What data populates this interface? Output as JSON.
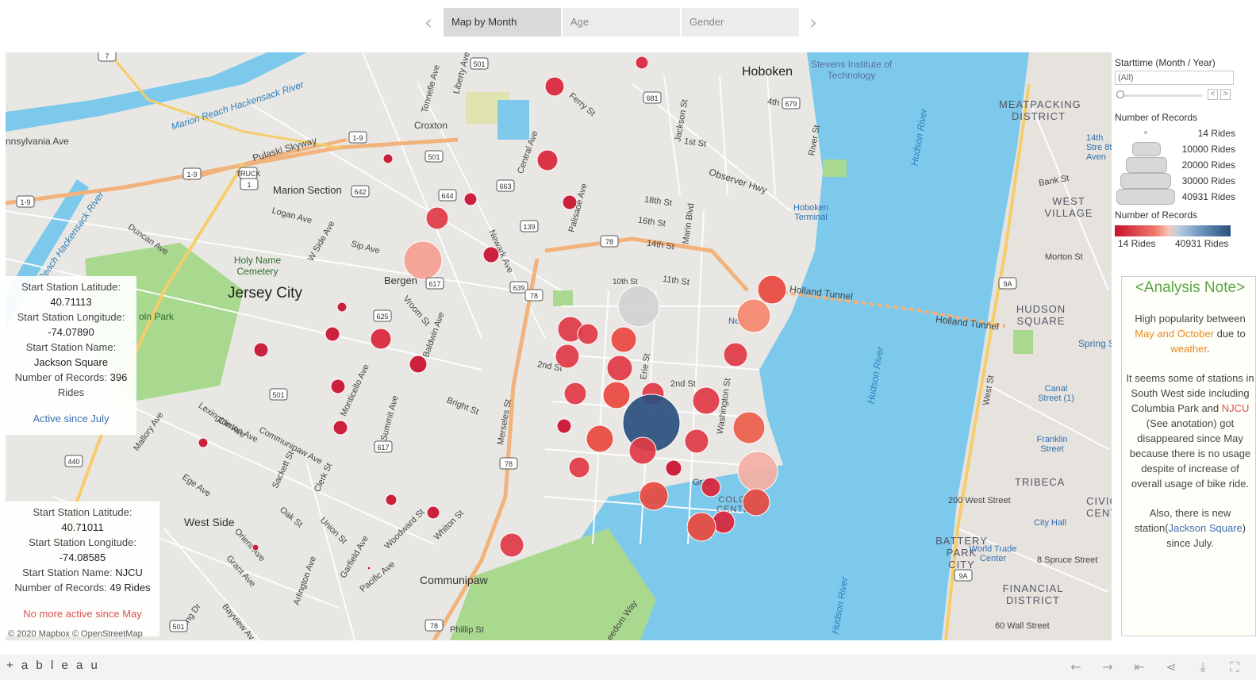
{
  "story": {
    "points": [
      {
        "label": "Map by Month",
        "active": true
      },
      {
        "label": "Age",
        "active": false
      },
      {
        "label": "Gender",
        "active": false
      }
    ],
    "prev_icon": "chevron-left-icon",
    "next_icon": "chevron-right-icon"
  },
  "map": {
    "labels": {
      "croxton": "Croxton",
      "hoboken": "Hoboken",
      "stevens": "Stevens Institute of Technology",
      "marion_section": "Marion Section",
      "jersey_city": "Jersey City",
      "bergen": "Bergen",
      "holy_name": "Holy Name Cemetery",
      "west_side": "West Side",
      "communipaw": "Communipaw",
      "holland_tunnel": "Holland Tunnel",
      "holland_tunnel_2": "Holland Tunnel",
      "hudson_river": "Hudson River",
      "hudson_river_2": "Hudson River",
      "hudson_river_3": "Hudson River",
      "marion_river": "Marion Reach Hackensack River",
      "reach_river": "Reach Hackensack River",
      "pennsylvania_ave": "nnsylvania Ave",
      "pulaski": "Pulaski Skyway",
      "observer": "Observer Hwy",
      "hoboken_terminal": "Hoboken Terminal",
      "meatpacking": "MEATPACKING DISTRICT",
      "west_village": "WEST VILLAGE",
      "hudson_square": "HUDSON SQUARE",
      "tribeca": "TRIBECA",
      "battery": "BATTERY PARK CITY",
      "financial": "FINANCIAL DISTRICT",
      "civic": "CIVIC CENTE",
      "spring": "Spring Street",
      "canal": "Canal Street (1)",
      "franklin": "Franklin Street",
      "city_hall": "City Hall",
      "wtc": "World Trade Center",
      "west_200": "200 West Street",
      "spruce": "8 Spruce Street",
      "wall_60": "60 Wall Street",
      "st14_8ave": "14th Stre 8th Aven",
      "west_st": "West St",
      "bank_st": "Bank St",
      "morton_st": "Morton St",
      "duncan": "Duncan Ave",
      "logan": "Logan Ave",
      "sip": "Sip Ave",
      "montgomery": "Montgomery",
      "monticello": "Monticello Ave",
      "summit": "Summit Ave",
      "communipaw_ave": "Communipaw Ave",
      "clinton": "Clinton Ave",
      "st18": "18th St",
      "st16": "16th St",
      "st14": "14th St",
      "st11": "11th St",
      "st10": "10th St",
      "st2": "2nd St",
      "st2b": "2nd St",
      "marin": "Marin Blvd",
      "washington": "Washington St",
      "erie": "Erie St",
      "grand": "Gr St",
      "colg": "COLG CENTE",
      "ne": "Ne",
      "lincoln_park": "oln Park",
      "bright": "Bright St",
      "merseles": "Merseles St",
      "newark": "Newark Ave",
      "palisade": "Palisade Ave",
      "central": "Central Ave",
      "ferry": "Ferry St",
      "st4": "4th St",
      "st1": "1st St",
      "jackson_st": "Jackson St",
      "river_st": "River St",
      "phillip": "Phillip St",
      "pacific": "Pacific Ave",
      "freedom": "eedom Way",
      "whiton": "Whiton St",
      "woodward": "Woodward St",
      "garfield": "Garfield Ave",
      "arlington": "Arlington Ave",
      "king": "King Dr",
      "bayview": "Bayview Av",
      "grant": "Grant Ave",
      "orient": "Orient Ave",
      "ege": "Ege Ave",
      "mallory": "Mallory Ave",
      "lexington": "Lexington Ave",
      "oak": "Oak St",
      "union": "Union St",
      "clerk": "Clerk St",
      "sackett": "Sackett St",
      "vroom": "Vroom St",
      "baldwin": "Baldwin Ave",
      "tonnelle": "Tonnelle Ave",
      "liberty": "Liberty Ave",
      "w_side": "W Side Ave"
    },
    "shields": [
      "7",
      "1-9",
      "1-9",
      "1-9",
      "501",
      "501",
      "501",
      "501",
      "642",
      "644",
      "663",
      "625",
      "617",
      "617",
      "639",
      "139",
      "440",
      "681",
      "679",
      "78",
      "78",
      "78",
      "78",
      "9A",
      "9A",
      "1",
      "TRUCK"
    ],
    "tooltip_jackson": {
      "lat_label": "Start Station Latitude:",
      "lat_value": "40.71113",
      "lon_label": "Start Station Longitude:",
      "lon_value": "-74.07890",
      "name_label": "Start Station Name:",
      "name_value": "Jackson Square",
      "records_label": "Number of Records:",
      "records_value": "396",
      "records_unit": "Rides",
      "note": "Active since July"
    },
    "tooltip_njcu": {
      "lat_label": "Start Station Latitude:",
      "lat_value": "40.71011",
      "lon_label": "Start Station Longitude:",
      "lon_value": "-74.08585",
      "name_label": "Start Station Name:",
      "name_value": "NJCU",
      "records_label": "Number of Records:",
      "records_value": "49 Rides",
      "note": "No more active since May"
    },
    "copyright": "© 2020 Mapbox © OpenStreetMap"
  },
  "filter": {
    "title": "Starttime (Month / Year)",
    "value": "(All)",
    "prev_label": "<",
    "next_label": ">"
  },
  "size_legend": {
    "title": "Number of Records",
    "items": [
      "14 Rides",
      "10000 Rides",
      "20000 Rides",
      "30000 Rides",
      "40931 Rides"
    ]
  },
  "color_legend": {
    "title": "Number of Records",
    "min_label": "14 Rides",
    "max_label": "40931 Rides",
    "colors": [
      "#c8102e",
      "#f5c7bc",
      "#2a4f7d"
    ]
  },
  "analysis_note": {
    "title": "<Analysis Note>",
    "p1_a": "High popularity between ",
    "p1_hl1": "May and October",
    "p1_b": " due to ",
    "p1_hl2": "weather",
    "p1_c": ".",
    "p2_a": "It seems some of stations in South West side including Columbia Park and ",
    "p2_hl": "NJCU",
    "p2_b": " (See anotation) got disappeared since May because there is no usage despite of increase of overall usage of bike ride.",
    "p3_a": "Also, there is new station(",
    "p3_hl": "Jackson Square",
    "p3_b": ") since July."
  },
  "toolbar": {
    "logo": "+ a b l e a u",
    "icons": [
      "undo-icon",
      "redo-icon",
      "revert-icon",
      "share-icon",
      "download-icon",
      "fullscreen-icon"
    ]
  }
}
